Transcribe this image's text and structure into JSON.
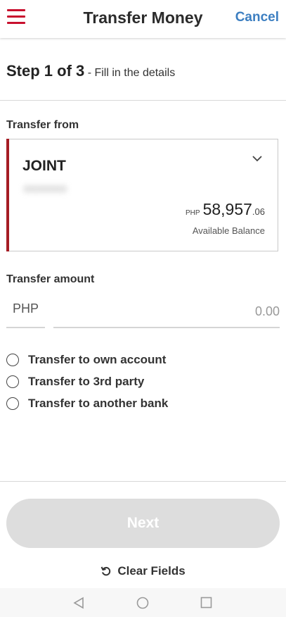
{
  "header": {
    "title": "Transfer Money",
    "cancel_label": "Cancel",
    "menu_icon": "hamburger-menu-icon",
    "accent_color": "#c8102e",
    "link_color": "#3d7fc1"
  },
  "step": {
    "main": "Step 1 of 3",
    "sub": " - Fill in the details"
  },
  "transfer_from": {
    "label": "Transfer from",
    "account_name": "JOINT",
    "account_number": "0000000",
    "balance_currency": "PHP",
    "balance_integer": "58,957",
    "balance_decimal": ".06",
    "balance_label": "Available Balance",
    "chevron_icon": "chevron-down-icon",
    "accent_color": "#a51c24"
  },
  "transfer_amount": {
    "label": "Transfer amount",
    "currency": "PHP",
    "placeholder": "0.00"
  },
  "options": [
    {
      "label": "Transfer to own account",
      "selected": false
    },
    {
      "label": "Transfer to 3rd party",
      "selected": false
    },
    {
      "label": "Transfer to another bank",
      "selected": false
    }
  ],
  "actions": {
    "next_label": "Next",
    "next_enabled": false,
    "clear_label": "Clear Fields",
    "clear_icon": "reset-icon"
  },
  "navbar": {
    "back_icon": "back-triangle-icon",
    "home_icon": "home-circle-icon",
    "recents_icon": "recents-square-icon"
  }
}
